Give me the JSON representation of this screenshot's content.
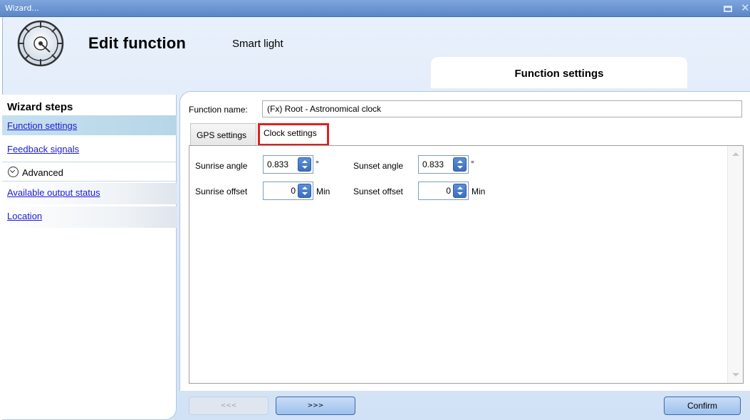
{
  "window": {
    "title": "Wizard..."
  },
  "header": {
    "title": "Edit function",
    "subtitle": "Smart light",
    "section_tab": "Function settings"
  },
  "sidebar": {
    "title": "Wizard steps",
    "items": [
      {
        "label": "Function settings",
        "active": true
      },
      {
        "label": "Feedback signals",
        "active": false
      }
    ],
    "advanced": {
      "label": "Advanced",
      "icon": "chevron-down-circle-icon"
    },
    "advanced_items": [
      {
        "label": "Available output status"
      },
      {
        "label": "Location"
      }
    ]
  },
  "main": {
    "function_name_label": "Function name:",
    "function_name_value": "(Fx) Root - Astronomical clock",
    "tabs": [
      {
        "label": "GPS settings",
        "selected": false
      },
      {
        "label": "Clock settings",
        "selected": true
      }
    ],
    "fields": {
      "sunrise_angle": {
        "label": "Sunrise angle",
        "value": "0.833",
        "unit": "°"
      },
      "sunset_angle": {
        "label": "Sunset angle",
        "value": "0.833",
        "unit": "°"
      },
      "sunrise_offset": {
        "label": "Sunrise offset",
        "value": "0",
        "unit": "Min"
      },
      "sunset_offset": {
        "label": "Sunset offset",
        "value": "0",
        "unit": "Min"
      }
    }
  },
  "footer": {
    "prev_label": "<<<",
    "next_label": ">>>",
    "confirm_label": "Confirm"
  },
  "colors": {
    "titlebar": "#5b86c7",
    "highlight_border": "#e02020",
    "link": "#1b1bd8",
    "spin_button": "#3b6fc2"
  }
}
